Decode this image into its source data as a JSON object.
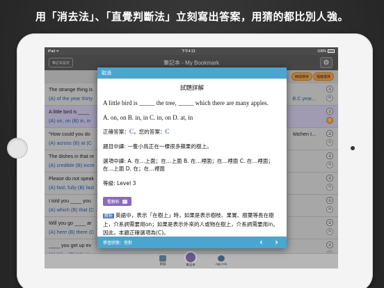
{
  "headline": "用「消去法」、「直覺判斷法」立刻寫出答案，用猜的都比別人強。",
  "status": {
    "left": "iPad ᯤ",
    "time": "下午4:13",
    "battery": "100%"
  },
  "nav": {
    "left_button": "筆記本設定",
    "title": "筆記本 - My Bookmark"
  },
  "filters": [
    "時間排序",
    "隨機選擇"
  ],
  "questions": [
    {
      "q": "The strange thing is",
      "opts": "(A) of the year thirty",
      "num": "③",
      "opts_right": "B.C year..."
    },
    {
      "q": "A little bird is ____",
      "opts": "(A) on, on  (B) in, in",
      "num": "③",
      "selected": true
    },
    {
      "q": "\"How could you do",
      "opts": "(A) across  (B) at  (C",
      "num": "③",
      "q_right": "kitchen t..."
    },
    {
      "q": "The dishes in that re",
      "opts": "(A) credible  (B) incre",
      "num": "②"
    },
    {
      "q": "Please do not speak",
      "opts": "(A) fast; fully  (B) fast",
      "num": "②"
    },
    {
      "q": "I told you ____ you",
      "opts": "(A) which  (B) that  (C",
      "num": "②"
    },
    {
      "q": "Will you go ____ ar",
      "opts": "(A) here  (B) there  (C",
      "num": "②"
    },
    {
      "q": "____ you get up ev",
      "opts": "(A) Why  (B) Which c",
      "num": "②"
    }
  ],
  "modal": {
    "cancel": "取消",
    "title": "試題詳解",
    "question": "A little bird is _____ the tree, _____ which there are many apples.",
    "choices": "A. on, on   B. in, in   C. in, on   D. at, in",
    "answer_label": "正確答案：",
    "answer": "C",
    "your_label": "，您的答案：",
    "your_answer": "C",
    "q_translation": "題目中譯: 一隻小鳥正在一棵很多蘋果的樹上。",
    "choices_translation": "選項中譯: A. 在…上面；在…上面  B. 在…裡面；在…裡面  C. 在…裡面；在…上面  D. 在；在…裡面",
    "level": "等級: Level 3",
    "explain_button": "看解析",
    "explain_tag": "解析",
    "explanation": "英語中，表示「在樹上」時，如果是表示樹枝、果實、樹葉等長在樹上，介系詞需要用on；如果是表示外來的人或物在樹上，介系詞需要用in。因此，本題正確選項為(C)。",
    "footer": "學習狀態：答對"
  },
  "tabs": [
    {
      "label": "目錄",
      "icon": "list-icon"
    },
    {
      "label": "筆記本",
      "icon": "bookmark-icon"
    },
    {
      "label": "App Info",
      "icon": "info-icon"
    }
  ],
  "colors": {
    "accent": "#4aa6cf",
    "purple": "#8a6bbf",
    "orange": "#f1a24a"
  }
}
